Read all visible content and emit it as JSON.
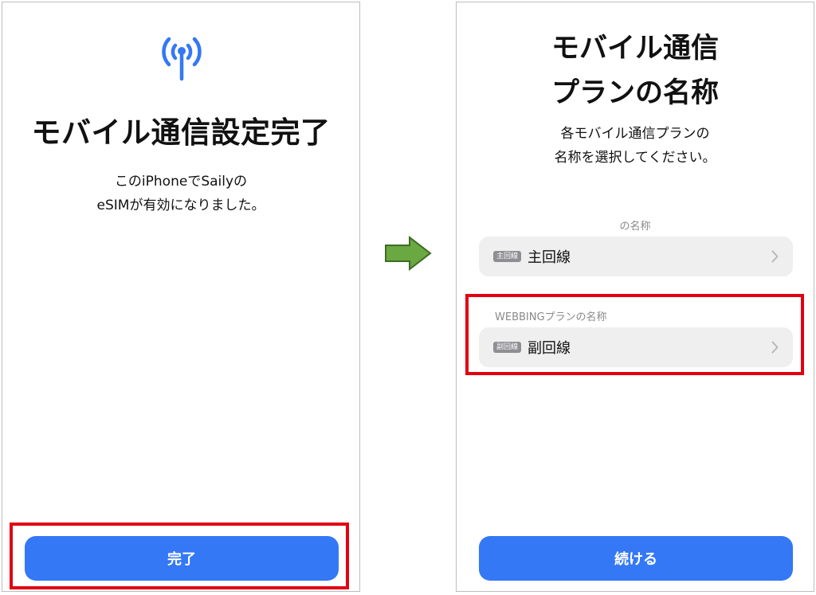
{
  "left": {
    "icon": "cellular-antenna-icon",
    "title": "モバイル通信設定完了",
    "description_line1": "このiPhoneでSailyの",
    "description_line2": "eSIMが有効になりました。",
    "done_button": "完了"
  },
  "right": {
    "title_line1": "モバイル通信",
    "title_line2": "プランの名称",
    "description_line1": "各モバイル通信プランの",
    "description_line2": "名称を選択してください。",
    "primary_section_label": "の名称",
    "primary_badge": "主回線",
    "primary_label": "主回線",
    "secondary_section_label": "WEBBINGプランの名称",
    "secondary_badge": "副回線",
    "secondary_label": "副回線",
    "continue_button": "続ける"
  },
  "colors": {
    "accent": "#3478f6",
    "highlight": "#e00012",
    "arrow": "#6aa842"
  }
}
